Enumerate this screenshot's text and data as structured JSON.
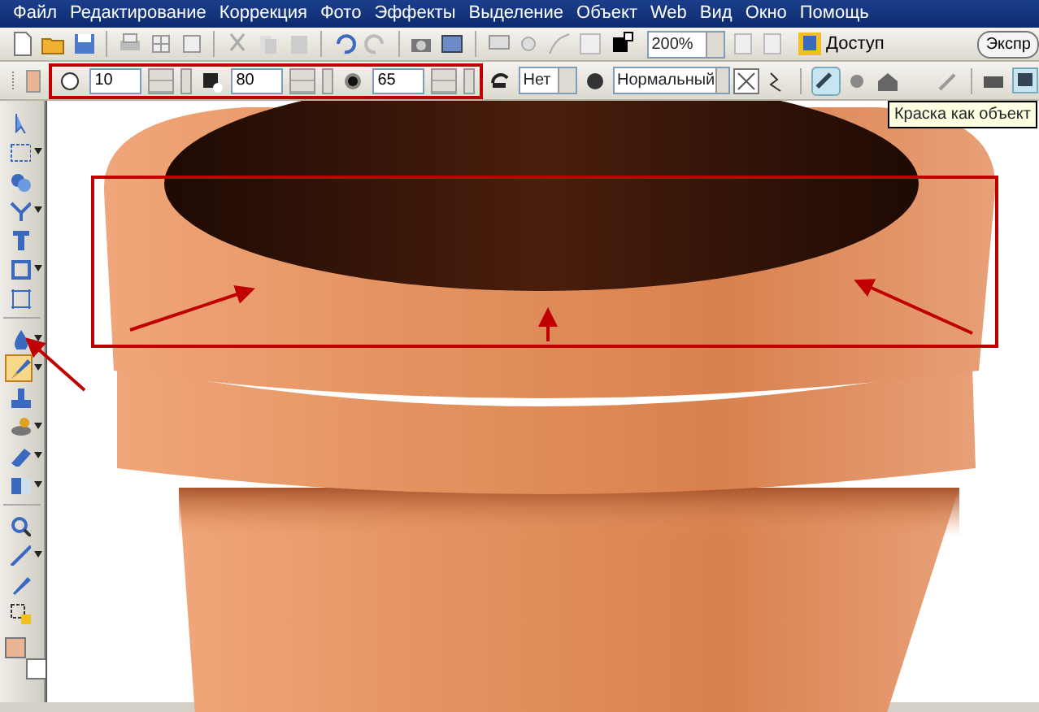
{
  "menu": [
    "Файл",
    "Редактирование",
    "Коррекция",
    "Фото",
    "Эффекты",
    "Выделение",
    "Объект",
    "Web",
    "Вид",
    "Окно",
    "Помощь"
  ],
  "toolbar": {
    "zoom": "200%",
    "share_button": "Доступ",
    "express_button": "Экспр"
  },
  "options": {
    "color": "#e8b494",
    "size": "10",
    "transparency": "80",
    "softness": "65",
    "texture": "Нет",
    "blend_mode": "Нормальный",
    "paint_as_object": true,
    "tooltip": "Краска как объект"
  },
  "tools": [
    {
      "dropdown": false,
      "selected": false
    },
    {
      "dropdown": true,
      "selected": false
    },
    {
      "dropdown": false,
      "selected": false
    },
    {
      "dropdown": true,
      "selected": false
    },
    {
      "dropdown": false,
      "selected": false
    },
    {
      "dropdown": true,
      "selected": false
    },
    {
      "dropdown": false,
      "selected": false
    },
    {
      "dropdown": true,
      "selected": false
    },
    {
      "dropdown": true,
      "selected": true
    },
    {
      "dropdown": false,
      "selected": false
    },
    {
      "dropdown": true,
      "selected": false
    },
    {
      "dropdown": true,
      "selected": false
    },
    {
      "dropdown": true,
      "selected": false
    },
    {
      "dropdown": false,
      "selected": false
    },
    {
      "dropdown": true,
      "selected": false
    },
    {
      "dropdown": false,
      "selected": false
    },
    {
      "dropdown": false,
      "selected": false
    }
  ],
  "swatches": [
    {
      "color": "#e8b494"
    },
    {
      "color": "#ffffff"
    }
  ]
}
